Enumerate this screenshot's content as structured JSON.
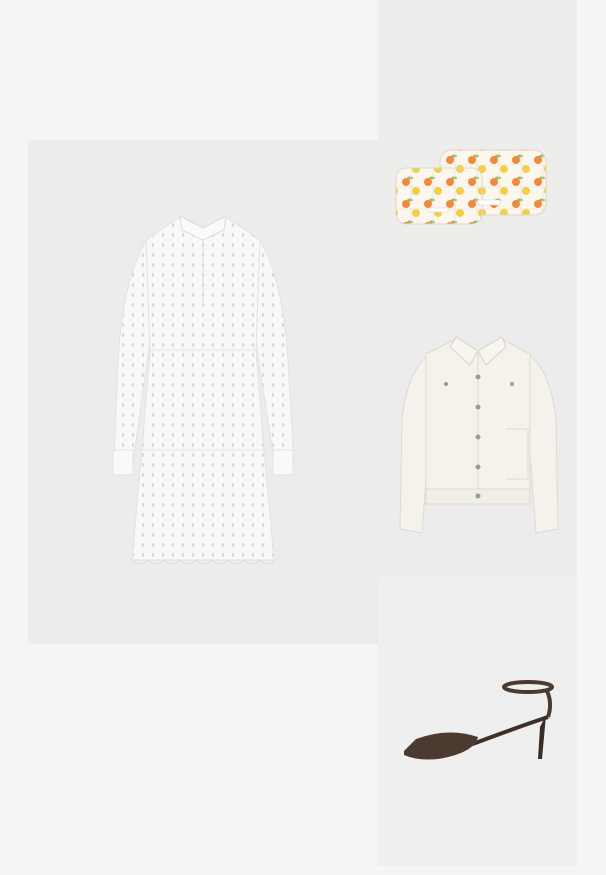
{
  "outfit": {
    "items": [
      {
        "id": "dress",
        "kind": "white eyelet tiered dress"
      },
      {
        "id": "bags",
        "kind": "quilted fruit-print pouch set"
      },
      {
        "id": "jacket",
        "kind": "off-white button jacket"
      },
      {
        "id": "shoe",
        "kind": "brown slingback pump"
      }
    ]
  },
  "colors": {
    "page_bg": "#f5f5f5",
    "tile_bg": "#ececec",
    "dress": "#f7f7f7",
    "jacket": "#f3f1ea",
    "shoe": "#4a3a30",
    "fruit_orange": "#ef8a3c",
    "fruit_yellow": "#f2cf4a",
    "leaf_green": "#9bb86a"
  }
}
